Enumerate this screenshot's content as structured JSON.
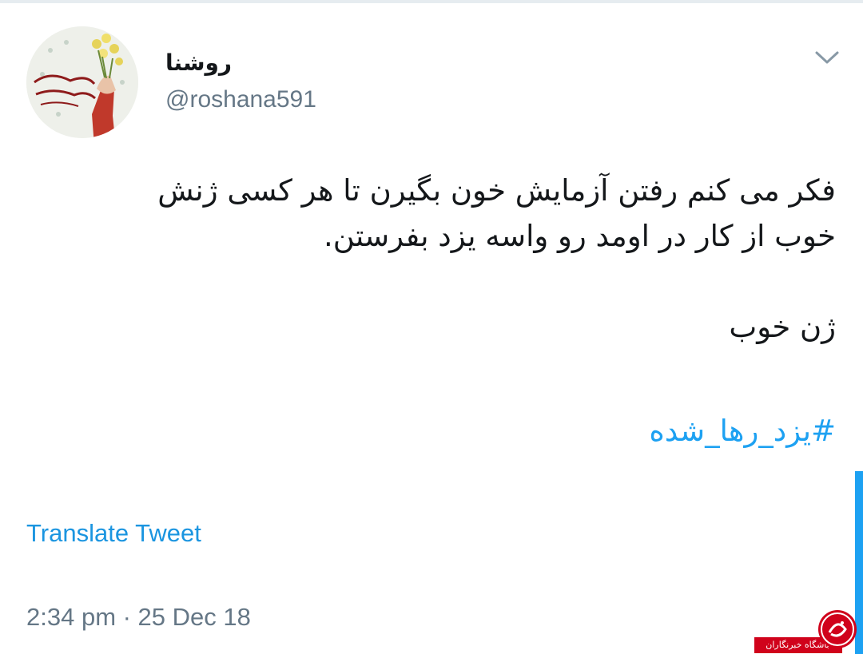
{
  "tweet": {
    "display_name": "روشنا",
    "handle": "@roshana591",
    "text_lines": [
      "فکر می کنم رفتن آزمایش خون بگیرن تا هر کسی ژنش",
      "خوب از کار در اومد رو واسه یزد بفرستن."
    ],
    "text_line_extra": "ژن خوب",
    "hashtag": "#یزد_رها_شده",
    "translate_label": "Translate Tweet",
    "timestamp": "2:34 pm · 25 Dec 18"
  },
  "watermark": {
    "text": "باشگاه خبرنگاران"
  },
  "colors": {
    "link": "#1da1f2",
    "translate": "#1b95e0",
    "secondary_text": "#657786",
    "primary_text": "#14171a",
    "watermark": "#d0021b"
  },
  "icons": {
    "menu": "chevron-down-icon",
    "avatar": "profile-avatar-image"
  }
}
